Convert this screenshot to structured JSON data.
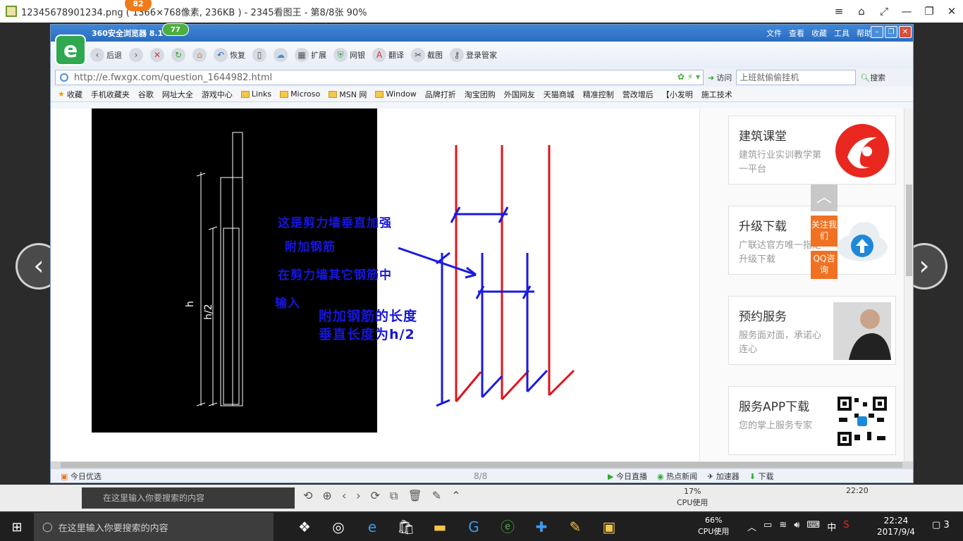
{
  "viewer": {
    "title": "12345678901234.png ( 1366×768像素, 236KB ) - 2345看图王 - 第8/8张 90%",
    "badge": "82",
    "controls": [
      "≡",
      "⌂",
      "⤢",
      "—",
      "❐",
      "✕"
    ]
  },
  "browser": {
    "title": "360安全浏览器 8.1",
    "badge": "77",
    "logo": "e",
    "menu": [
      "文件",
      "查看",
      "收藏",
      "工具",
      "帮助"
    ],
    "toolbar": {
      "back": "后退",
      "restore": "恢复",
      "extend": "扩展",
      "bank": "网银",
      "translate": "翻译",
      "screenshot": "截图",
      "login": "登录管家"
    },
    "address": "http://e.fwxgx.com/question_1644982.html",
    "visit_label": "访问",
    "search_placeholder": "上班就偷偷挂机",
    "search_label": "搜索",
    "bookmarks": [
      "收藏",
      "手机收藏夹",
      "谷歌",
      "网址大全",
      "游戏中心",
      "Links",
      "Microso",
      "MSN 网",
      "Window",
      "品牌打折",
      "淘宝团购",
      "外国网友",
      "天猫商城",
      "精准控制",
      "营改增后",
      "【小发明",
      "施工技术"
    ],
    "status": {
      "today": "今日优选",
      "pager": "8/8",
      "live": "今日直播",
      "news": "热点新闻",
      "accelerate": "加速器",
      "download": "下载"
    }
  },
  "page": {
    "cad": {
      "label_h": "h",
      "label_h2": "h/2"
    },
    "annotations": {
      "line1": "这是剪力墙垂直加强",
      "line2": "附加钢筋",
      "line3": "在剪力墙其它钢筋中",
      "line4": "输入",
      "line5": "附加钢筋的长度",
      "line6": "垂直长度为h/2"
    },
    "sidebar": [
      {
        "title": "建筑课堂",
        "desc": "建筑行业实训教学第一平台"
      },
      {
        "title": "升级下载",
        "desc": "广联达官方唯一指定升级下载"
      },
      {
        "title": "预约服务",
        "desc": "服务面对面，承诺心连心"
      },
      {
        "title": "服务APP下载",
        "desc": "您的掌上服务专家"
      }
    ],
    "float": {
      "top": "︿",
      "follow": "关注我们",
      "qq": "QQ咨询"
    }
  },
  "viewer_toolbar": {
    "search_placeholder": "在这里输入你要搜索的内容",
    "cpu_percent": "17%",
    "cpu_label": "CPU使用",
    "ime": "中",
    "time": "22:20"
  },
  "taskbar": {
    "search_placeholder": "在这里输入你要搜索的内容",
    "cpu_percent": "66%",
    "cpu_label": "CPU使用",
    "ime": "中",
    "time": "22:24",
    "date": "2017/9/4",
    "notifications": "3"
  },
  "colors": {
    "annotation": "#1616d9",
    "red_bar": "#e0141b",
    "blue_bar": "#1a1ae0",
    "accent_orange": "#f07121",
    "browser_blue": "#2a6cc0"
  }
}
